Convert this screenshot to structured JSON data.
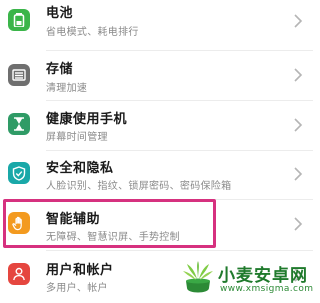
{
  "settings": {
    "items": [
      {
        "title": "电池",
        "subtitle": "省电模式、耗电排行",
        "icon": "battery-icon",
        "color": "#3bb54a"
      },
      {
        "title": "存储",
        "subtitle": "清理加速",
        "icon": "storage-icon",
        "color": "#6f6f6f"
      },
      {
        "title": "健康使用手机",
        "subtitle": "屏幕时间管理",
        "icon": "hourglass-icon",
        "color": "#2f9b66"
      },
      {
        "title": "安全和隐私",
        "subtitle": "人脸识别、指纹、锁屏密码、密码保险箱",
        "icon": "shield-icon",
        "color": "#19a8a8"
      },
      {
        "title": "智能辅助",
        "subtitle": "无障碍、智慧识屏、手势控制",
        "icon": "hand-icon",
        "color": "#f39a1f"
      },
      {
        "title": "用户和帐户",
        "subtitle": "多用户、帐户",
        "icon": "user-icon",
        "color": "#e5463f"
      }
    ]
  },
  "highlight_color": "#d6317f",
  "watermark": {
    "title": "小麦安卓网",
    "url": "www.xmsigma.com",
    "color": "#1f7a2c"
  }
}
